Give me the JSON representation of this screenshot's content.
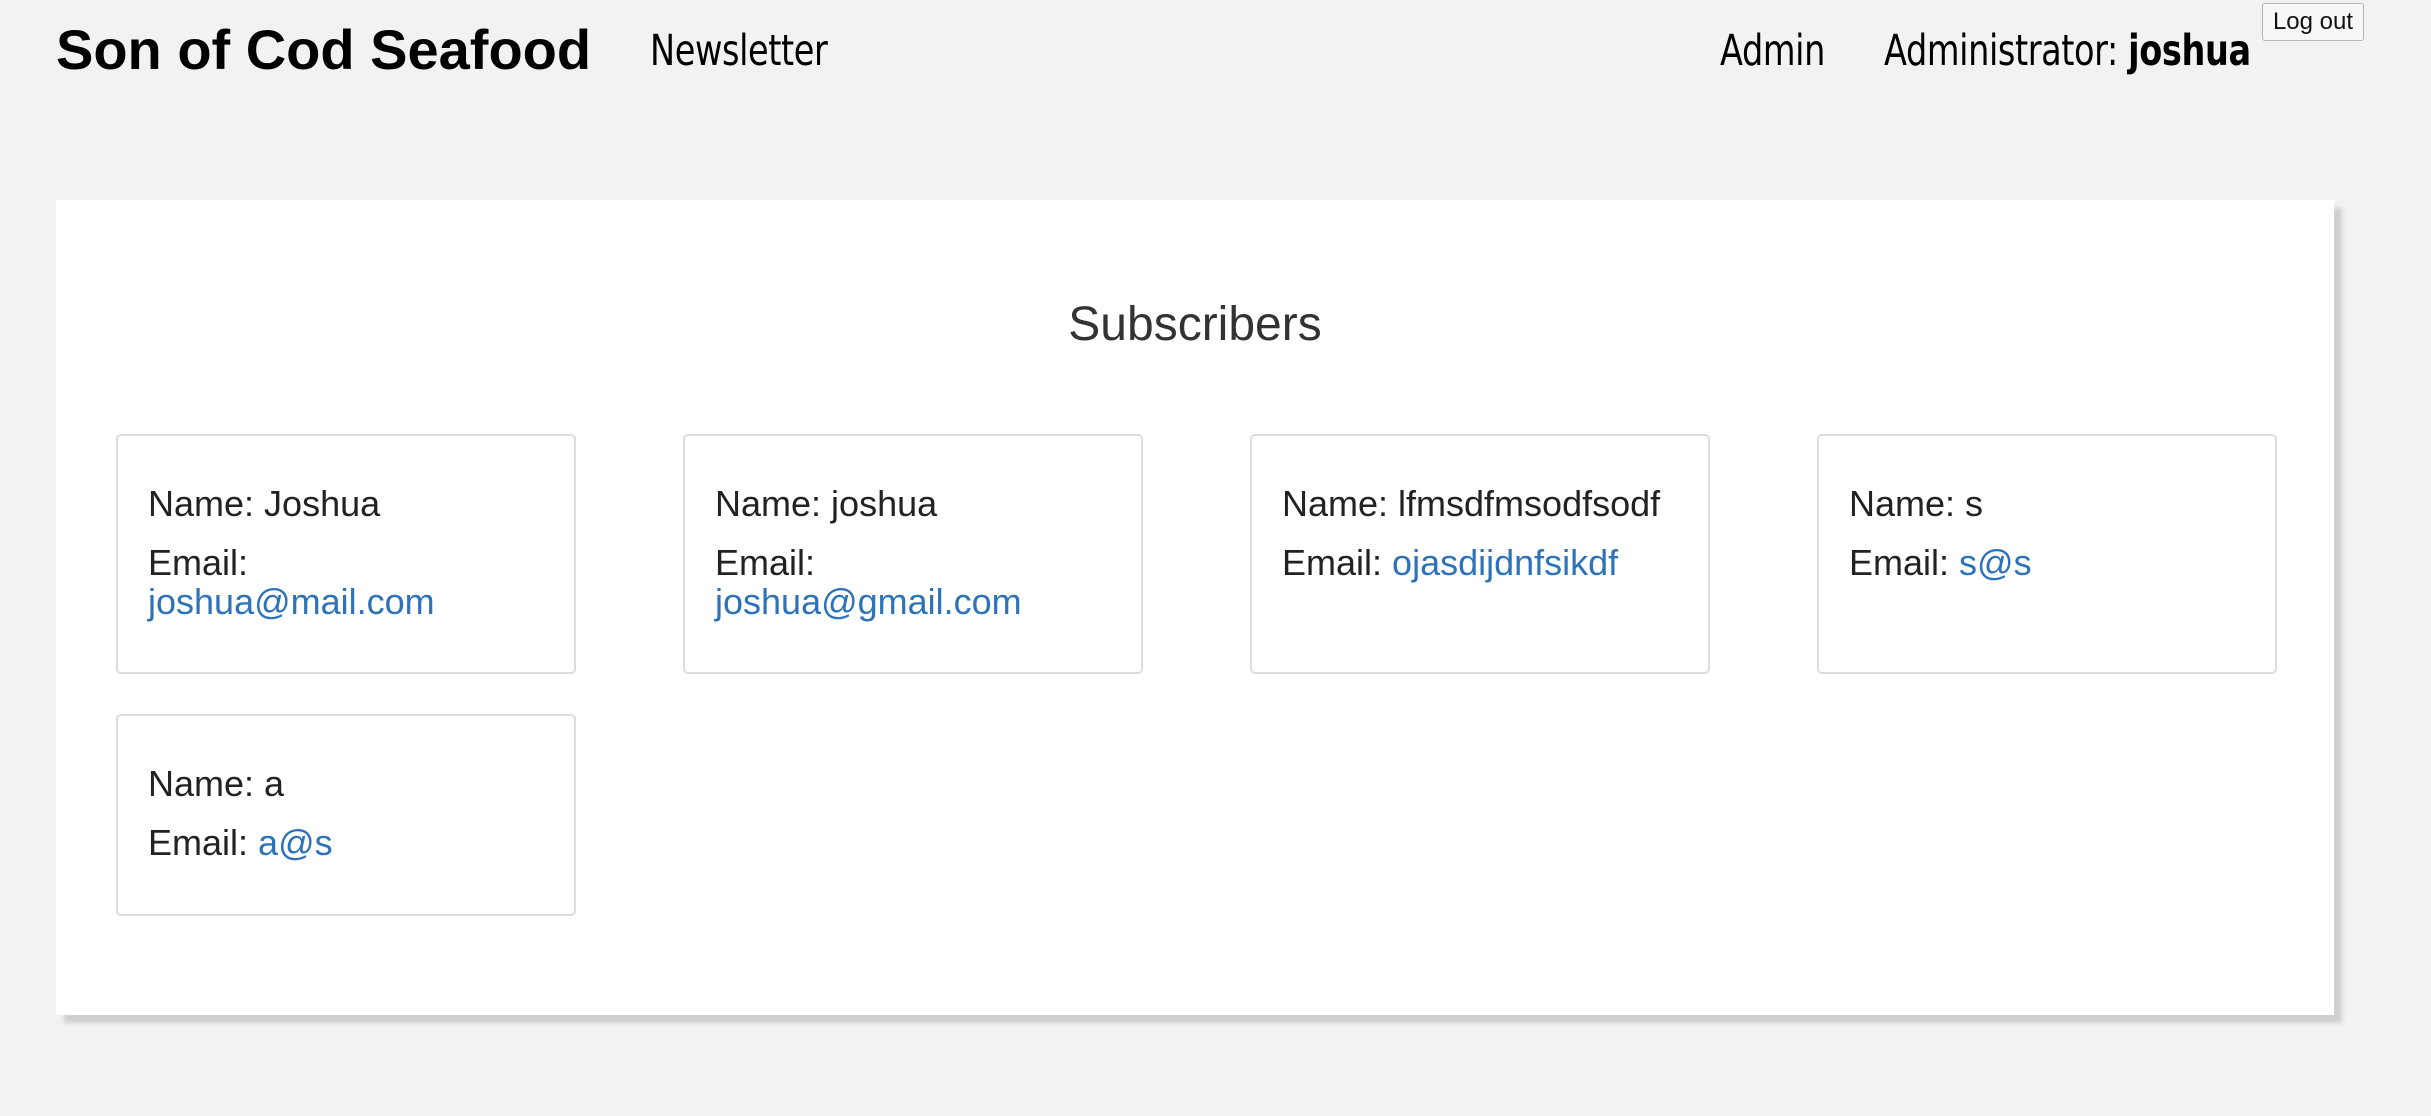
{
  "header": {
    "brand": "Son of Cod Seafood",
    "nav_newsletter": "Newsletter",
    "nav_admin": "Admin",
    "admin_label": "Administrator:",
    "admin_user": "joshua",
    "logout_label": "Log out"
  },
  "main": {
    "title": "Subscribers",
    "name_prefix": "Name:",
    "email_prefix": "Email:",
    "subscribers": [
      {
        "name": "Joshua",
        "email": "joshua@mail.com"
      },
      {
        "name": "joshua",
        "email": "joshua@gmail.com"
      },
      {
        "name": "lfmsdfmsodfsodf",
        "email": "ojasdijdnfsikdf"
      },
      {
        "name": "s",
        "email": "s@s"
      },
      {
        "name": "a",
        "email": "a@s"
      }
    ]
  },
  "colors": {
    "page_background": "#f2f2f2",
    "panel_background": "#ffffff",
    "link": "#2e72b8",
    "card_border": "#dddddd"
  }
}
